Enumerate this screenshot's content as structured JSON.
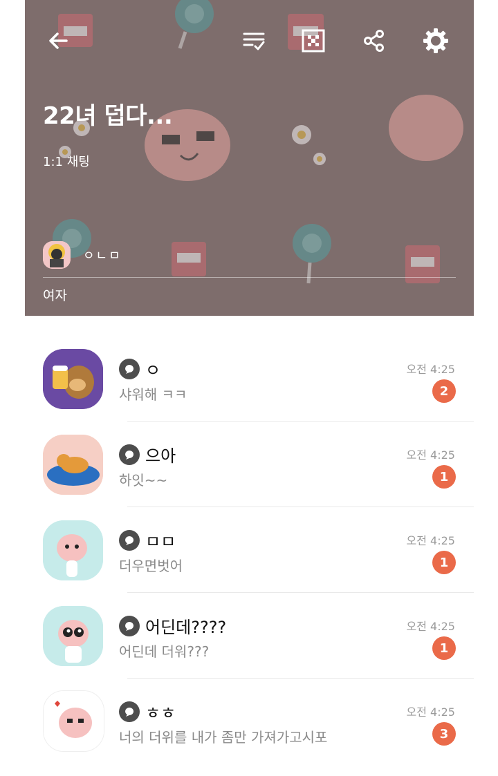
{
  "header": {
    "title": "22녀 덥다...",
    "subtitle": "1:1 채팅",
    "owner_name": "ㅇㄴㅁ",
    "owner_desc": "여자",
    "icons": [
      "back-arrow-icon",
      "checklist-icon",
      "qr-code-icon",
      "share-icon",
      "settings-gear-icon"
    ]
  },
  "chats": [
    {
      "name": "ㅇ",
      "preview": "샤워해 ㅋㅋ",
      "time": "오전 4:25",
      "unread": "2"
    },
    {
      "name": "으아",
      "preview": "하잇~~",
      "time": "오전 4:25",
      "unread": "1"
    },
    {
      "name": "ㅁㅁ",
      "preview": "더우면벗어",
      "time": "오전 4:25",
      "unread": "1"
    },
    {
      "name": "어딘데????",
      "preview": "어딘데 더워???",
      "time": "오전 4:25",
      "unread": "1"
    },
    {
      "name": "ㅎㅎ",
      "preview": "너의 더위를 내가 좀만 가져가고시포",
      "time": "오전 4:25",
      "unread": "3"
    }
  ],
  "colors": {
    "header_bg": "#7e6d6c",
    "badge": "#ea6a49"
  }
}
